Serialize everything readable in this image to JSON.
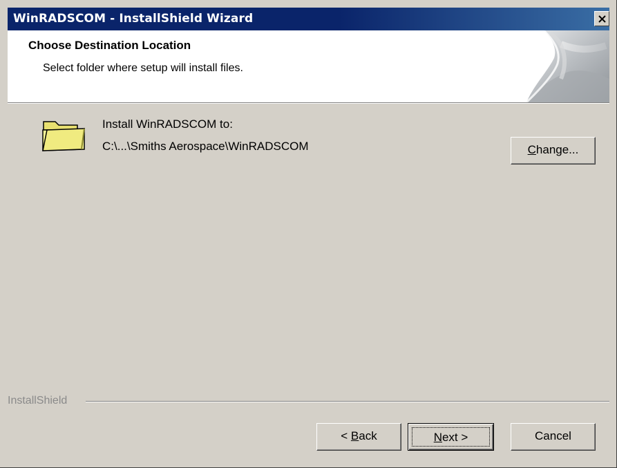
{
  "window": {
    "title": "WinRADSCOM - InstallShield Wizard",
    "title_bar_color": "#0a246a",
    "face_color": "#d4d0c8",
    "close_icon": "close-icon"
  },
  "header": {
    "title": "Choose Destination Location",
    "subtitle": "Select folder where setup will install files."
  },
  "destination": {
    "icon": "folder-icon",
    "label": "Install WinRADSCOM to:",
    "path": "C:\\...\\Smiths Aerospace\\WinRADSCOM",
    "change_button": {
      "mnemonic": "C",
      "rest": "hange..."
    }
  },
  "footer": {
    "brand": "InstallShield",
    "back_button": {
      "prefix": "< ",
      "mnemonic": "B",
      "rest": "ack"
    },
    "next_button": {
      "mnemonic": "N",
      "rest": "ext >"
    },
    "cancel_button": "Cancel"
  }
}
